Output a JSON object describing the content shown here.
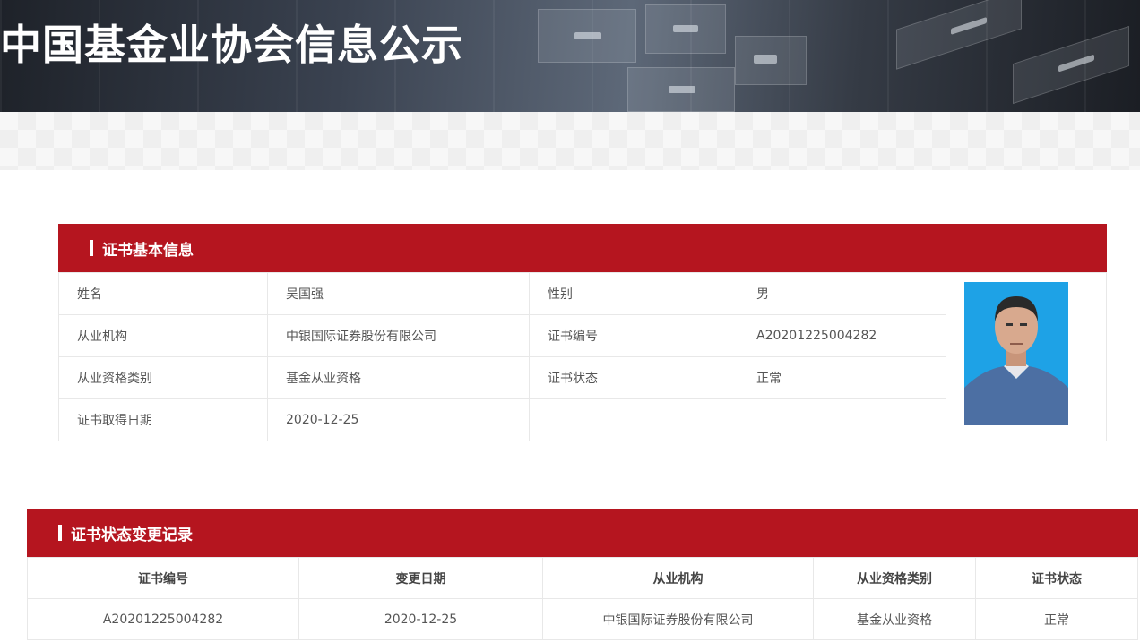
{
  "site": {
    "title": "中国基金业协会信息公示"
  },
  "basic_info": {
    "heading": "证书基本信息",
    "fields": {
      "name_label": "姓名",
      "name_value": "吴国强",
      "gender_label": "性别",
      "gender_value": "男",
      "org_label": "从业机构",
      "org_value": "中银国际证券股份有限公司",
      "cert_no_label": "证书编号",
      "cert_no_value": "A20201225004282",
      "qual_label": "从业资格类别",
      "qual_value": "基金从业资格",
      "status_label": "证书状态",
      "status_value": "正常",
      "date_label": "证书取得日期",
      "date_value": "2020-12-25"
    }
  },
  "status_records": {
    "heading": "证书状态变更记录",
    "columns": [
      "证书编号",
      "变更日期",
      "从业机构",
      "从业资格类别",
      "证书状态"
    ],
    "rows": [
      [
        "A20201225004282",
        "2020-12-25",
        "中银国际证券股份有限公司",
        "基金从业资格",
        "正常"
      ]
    ]
  },
  "colors": {
    "accent": "#b5151f",
    "photo_bg": "#1ea2e6"
  }
}
